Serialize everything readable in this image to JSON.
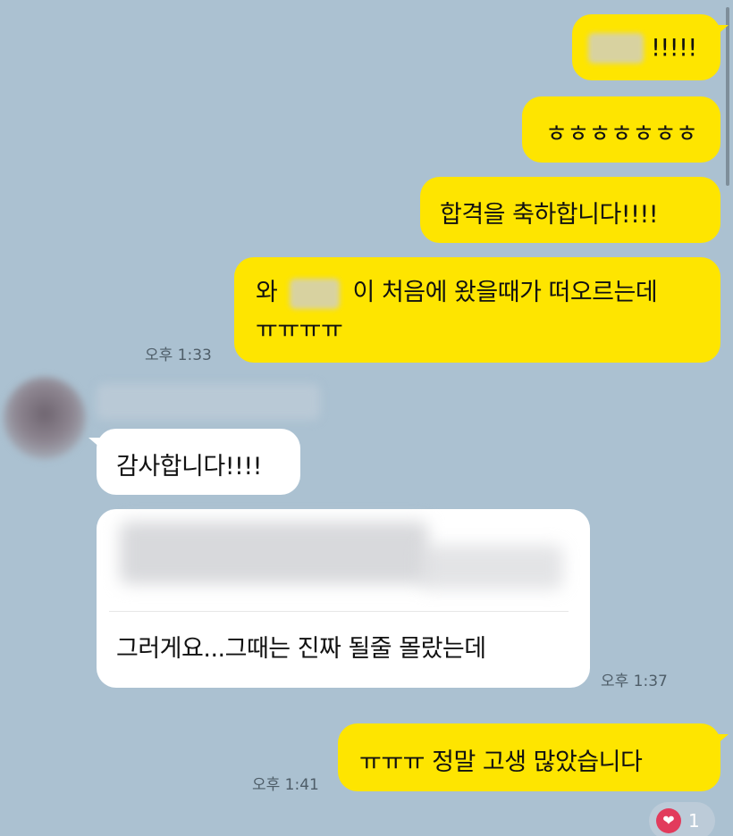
{
  "messages": {
    "m1_suffix": "!!!!!",
    "m2": "ㅎㅎㅎㅎㅎㅎㅎ",
    "m3": "합격을 축하합니다!!!!",
    "m4_prefix": "와",
    "m4_suffix": "이 처음에 왔을때가 떠오르는데",
    "m4_line2": "ㅠㅠㅠㅠ",
    "m5": "감사합니다!!!!",
    "m6": "그러게요...그때는 진짜 될줄 몰랐는데",
    "m7": "ㅠㅠㅠ 정말 고생 많았습니다"
  },
  "times": {
    "t1": "오후 1:33",
    "t2": "오후 1:37",
    "t3": "오후 1:41"
  },
  "reaction": {
    "icon": "heart-icon",
    "count": "1",
    "color": "#e23b5c"
  },
  "colors": {
    "background": "#abc1d1",
    "my_bubble": "#fee500",
    "their_bubble": "#ffffff"
  }
}
